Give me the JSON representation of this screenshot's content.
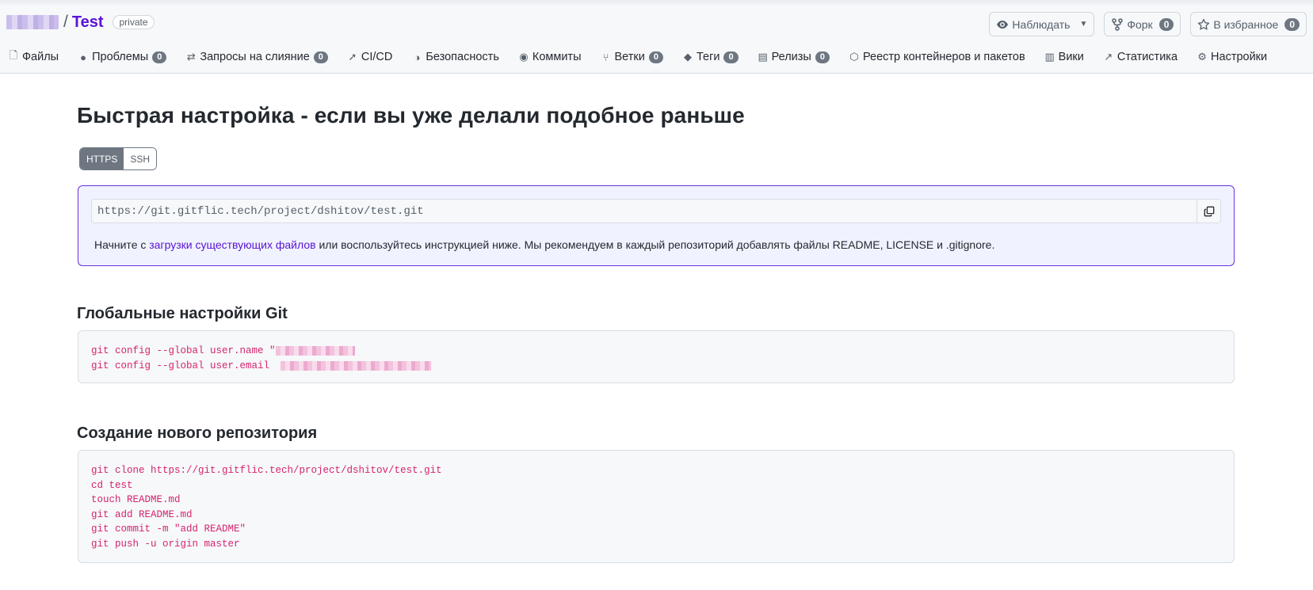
{
  "header": {
    "repo_name": "Test",
    "visibility": "private",
    "slash": "/",
    "actions": [
      {
        "icon": "eye-icon",
        "label": "Наблюдать",
        "count": "",
        "dropdown": true
      },
      {
        "icon": "fork-icon",
        "label": "Форк",
        "count": "0"
      },
      {
        "icon": "star-icon",
        "label": "В избранное",
        "count": "0"
      }
    ]
  },
  "tabs": [
    {
      "icon": "file-icon",
      "label": "Файлы",
      "count": ""
    },
    {
      "icon": "issue-icon",
      "label": "Проблемы",
      "count": "0"
    },
    {
      "icon": "merge-request-icon",
      "label": "Запросы на слияние",
      "count": "0"
    },
    {
      "icon": "rocket-icon",
      "label": "CI/CD",
      "count": ""
    },
    {
      "icon": "shield-icon",
      "label": "Безопасность",
      "count": ""
    },
    {
      "icon": "commit-icon",
      "label": "Коммиты",
      "count": ""
    },
    {
      "icon": "branch-icon",
      "label": "Ветки",
      "count": "0"
    },
    {
      "icon": "tag-icon",
      "label": "Теги",
      "count": "0"
    },
    {
      "icon": "archive-icon",
      "label": "Релизы",
      "count": "0"
    },
    {
      "icon": "package-icon",
      "label": "Реестр контейнеров и пакетов",
      "count": ""
    },
    {
      "icon": "book-icon",
      "label": "Вики",
      "count": ""
    },
    {
      "icon": "chart-icon",
      "label": "Статистика",
      "count": ""
    },
    {
      "icon": "gear-icon",
      "label": "Настройки",
      "count": ""
    }
  ],
  "quick_setup": {
    "title": "Быстрая настройка - если вы уже делали подобное раньше",
    "protocols": [
      "HTTPS",
      "SSH"
    ],
    "selected_protocol": "HTTPS",
    "clone_url": "https://git.gitflic.tech/project/dshitov/test.git",
    "hint_before": "Начните с ",
    "hint_link": "загрузки существующих файлов",
    "hint_after": " или воспользуйтесь инструкцией ниже. Мы рекомендуем в каждый репозиторий добавлять файлы README, LICENSE и .gitignore."
  },
  "git_global": {
    "title": "Глобальные настройки Git",
    "line1": "git config --global user.name \"",
    "line2": "git config --global user.email "
  },
  "new_repo": {
    "title": "Создание нового репозитория",
    "lines": [
      "git clone https://git.gitflic.tech/project/dshitov/test.git",
      "cd test",
      "touch README.md",
      "git add README.md",
      "git commit -m \"add README\"",
      "git push -u origin master"
    ]
  }
}
